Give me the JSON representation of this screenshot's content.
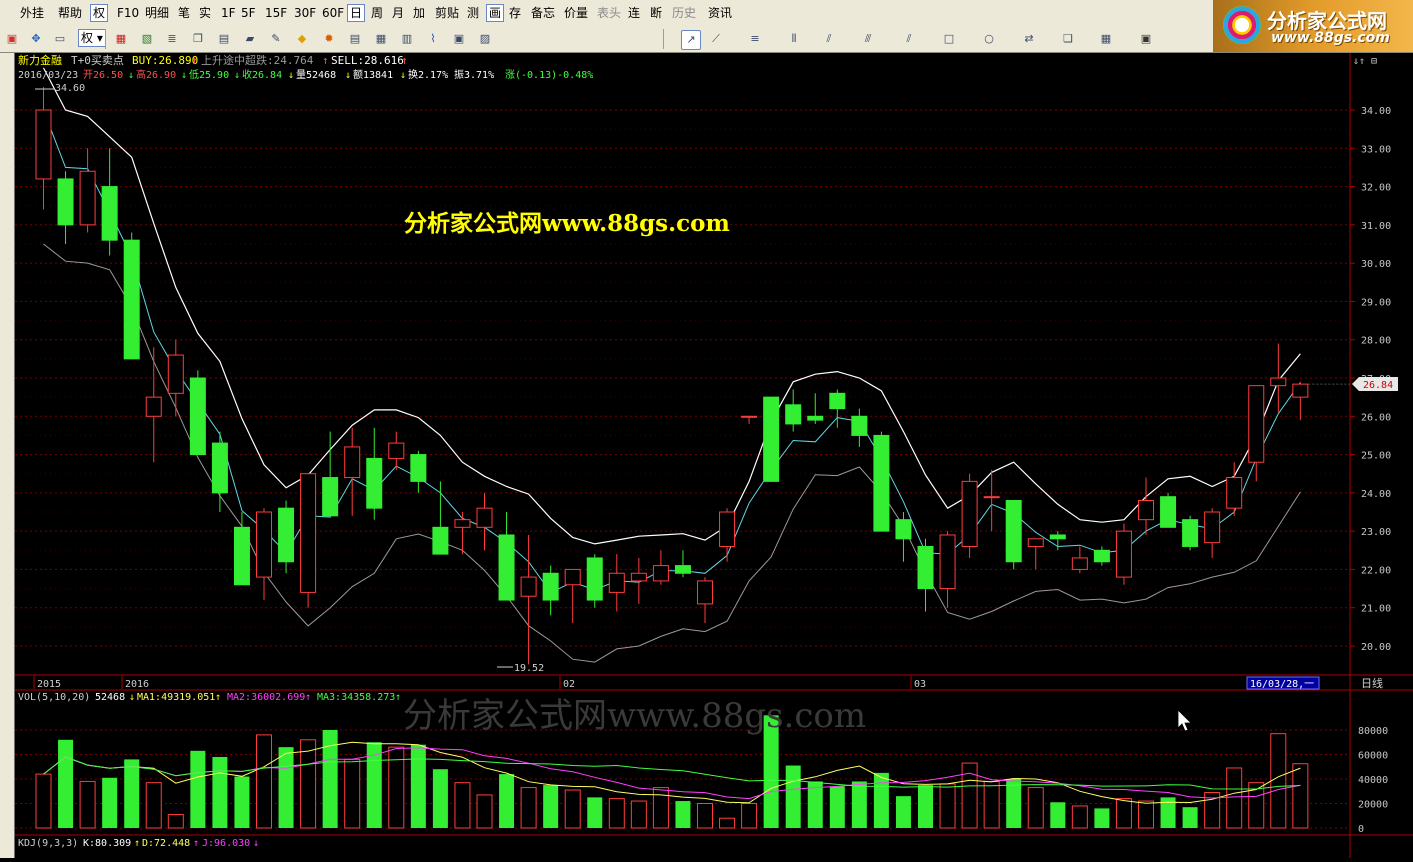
{
  "menu": {
    "items": [
      "外挂",
      "帮助",
      "权",
      "F10",
      "明细",
      "笔",
      "实",
      "1F",
      "5F",
      "15F",
      "30F",
      "60F",
      "日",
      "周",
      "月",
      "加",
      "剪贴",
      "测",
      "画",
      "存",
      "备忘",
      "价量",
      "表头",
      "连",
      "断",
      "历史",
      "资讯"
    ],
    "active": [
      "权",
      "日",
      "画"
    ],
    "disabled": [
      "表头",
      "历史"
    ]
  },
  "toolbar": {
    "quan_dropdown": "权",
    "icons": [
      "app-icon",
      "move-icon",
      "ruler-icon",
      "quan-dropdown",
      "red-chart-icon",
      "green-chart-icon",
      "bars-icon",
      "copy-icon",
      "note-icon",
      "eraser-icon",
      "edit-icon",
      "warning-icon",
      "target-icon",
      "compare-icon",
      "table-icon",
      "small-chart-icon",
      "line-chart-icon",
      "window-icon",
      "print-icon",
      "draw-cursor-icon",
      "line-tool-icon",
      "text-tool-icon",
      "vbars-tool-icon",
      "fan-tool-icon",
      "parallel-tool-icon",
      "channel-tool-icon",
      "rect-tool-icon",
      "ellipse-tool-icon",
      "arrow-tool-icon",
      "copy-tool-icon",
      "palette-icon",
      "save-icon"
    ]
  },
  "logo": {
    "title": "分析家公式网",
    "url": "www.88gs.com"
  },
  "header": {
    "stock_name": "新力金融",
    "indicator": "T+0买卖点",
    "buy": "BUY:26.890",
    "note": "上升途中超跌:24.764",
    "sell": "SELL:28.616",
    "date": "2016/03/23",
    "open": "开26.50",
    "high": "高26.90",
    "low": "低25.90",
    "close": "收26.84",
    "volume": "量52468",
    "amount": "额13841",
    "turnover": "换2.17%",
    "amplitude": "振3.71%",
    "change": "涨(-0.13)-0.48%"
  },
  "watermarks": {
    "main": "分析家公式网www.88gs.com",
    "volume": "分析家公式网www.88gs.com"
  },
  "scale_buttons": [
    "⇓⇑",
    "⊟"
  ],
  "colors": {
    "up": "#ff3c3c",
    "down": "#33ee33",
    "bg": "#000000",
    "grid": "#7a0000",
    "axis_text": "#c8c8c8",
    "ma1": "#ffff60",
    "ma2": "#ff40ff",
    "ma3": "#40ff40",
    "band_upper": "#ffffff",
    "band_lower": "#9a9a9a"
  },
  "x_axis": {
    "labels": [
      "2015",
      "2016",
      "02",
      "03"
    ],
    "cursor_date": "16/03/28,一",
    "period": "日线"
  },
  "price_panel": {
    "y_ticks": [
      "34.00",
      "33.00",
      "32.00",
      "31.00",
      "30.00",
      "29.00",
      "28.00",
      "27.00",
      "26.00",
      "25.00",
      "24.00",
      "23.00",
      "22.00",
      "21.00",
      "20.00"
    ],
    "current_price": "26.84",
    "max_label": "34.60",
    "min_label": "19.52"
  },
  "volume_panel": {
    "header": {
      "name": "VOL(5,10,20)",
      "value": "52468",
      "ma1": "MA1:49319.051",
      "ma2": "MA2:36002.699",
      "ma3": "MA3:34358.273"
    },
    "y_ticks": [
      "80000",
      "60000",
      "40000",
      "20000",
      "0"
    ]
  },
  "kdj_header": {
    "name": "KDJ(9,3,3)",
    "k": "K:80.309",
    "d": "D:72.448",
    "j": "J:96.030"
  },
  "chart_data": {
    "type": "candlestick",
    "title": "新力金融",
    "y_range": [
      19.52,
      34.6
    ],
    "volume_range": [
      0,
      80000
    ],
    "candles": [
      {
        "o": 32.2,
        "h": 34.6,
        "l": 31.4,
        "c": 34.0,
        "v": 44000
      },
      {
        "o": 32.2,
        "h": 32.4,
        "l": 30.5,
        "c": 31.0,
        "v": 72000
      },
      {
        "o": 31.0,
        "h": 33.0,
        "l": 30.8,
        "c": 32.4,
        "v": 38000
      },
      {
        "o": 32.0,
        "h": 33.0,
        "l": 30.2,
        "c": 30.6,
        "v": 41000
      },
      {
        "o": 30.6,
        "h": 30.8,
        "l": 27.5,
        "c": 27.5,
        "v": 56000
      },
      {
        "o": 26.0,
        "h": 27.8,
        "l": 24.8,
        "c": 26.5,
        "v": 37000
      },
      {
        "o": 26.6,
        "h": 28.0,
        "l": 26.0,
        "c": 27.6,
        "v": 11000
      },
      {
        "o": 27.0,
        "h": 27.2,
        "l": 25.0,
        "c": 25.0,
        "v": 63000
      },
      {
        "o": 25.3,
        "h": 25.6,
        "l": 23.5,
        "c": 24.0,
        "v": 58000
      },
      {
        "o": 23.1,
        "h": 23.5,
        "l": 21.6,
        "c": 21.6,
        "v": 42000
      },
      {
        "o": 21.8,
        "h": 23.6,
        "l": 21.2,
        "c": 23.5,
        "v": 76000
      },
      {
        "o": 23.6,
        "h": 23.8,
        "l": 21.9,
        "c": 22.2,
        "v": 66000
      },
      {
        "o": 21.4,
        "h": 24.5,
        "l": 21.0,
        "c": 24.5,
        "v": 72000
      },
      {
        "o": 24.4,
        "h": 25.6,
        "l": 23.5,
        "c": 23.4,
        "v": 80000
      },
      {
        "o": 24.4,
        "h": 25.7,
        "l": 23.4,
        "c": 25.2,
        "v": 56000
      },
      {
        "o": 24.9,
        "h": 25.7,
        "l": 23.3,
        "c": 23.6,
        "v": 70000
      },
      {
        "o": 24.9,
        "h": 25.6,
        "l": 24.6,
        "c": 25.3,
        "v": 66000
      },
      {
        "o": 25.0,
        "h": 25.1,
        "l": 24.0,
        "c": 24.3,
        "v": 68000
      },
      {
        "o": 23.1,
        "h": 24.3,
        "l": 22.6,
        "c": 22.4,
        "v": 48000
      },
      {
        "o": 23.1,
        "h": 23.5,
        "l": 22.4,
        "c": 23.3,
        "v": 37000
      },
      {
        "o": 23.1,
        "h": 24.0,
        "l": 22.5,
        "c": 23.6,
        "v": 27000
      },
      {
        "o": 22.9,
        "h": 23.5,
        "l": 21.3,
        "c": 21.2,
        "v": 44000
      },
      {
        "o": 21.3,
        "h": 22.9,
        "l": 19.52,
        "c": 21.8,
        "v": 33000
      },
      {
        "o": 21.9,
        "h": 22.1,
        "l": 20.8,
        "c": 21.2,
        "v": 35000
      },
      {
        "o": 21.6,
        "h": 22.0,
        "l": 20.6,
        "c": 22.0,
        "v": 31000
      },
      {
        "o": 22.3,
        "h": 22.4,
        "l": 21.0,
        "c": 21.2,
        "v": 25000
      },
      {
        "o": 21.4,
        "h": 22.4,
        "l": 20.9,
        "c": 21.9,
        "v": 24000
      },
      {
        "o": 21.7,
        "h": 22.3,
        "l": 21.1,
        "c": 21.9,
        "v": 22000
      },
      {
        "o": 21.7,
        "h": 22.5,
        "l": 21.6,
        "c": 22.1,
        "v": 33000
      },
      {
        "o": 22.1,
        "h": 22.5,
        "l": 21.8,
        "c": 21.9,
        "v": 22000
      },
      {
        "o": 21.1,
        "h": 21.8,
        "l": 20.6,
        "c": 21.7,
        "v": 20000
      },
      {
        "o": 22.6,
        "h": 23.6,
        "l": 22.2,
        "c": 23.5,
        "v": 8000
      },
      {
        "o": 26.0,
        "h": 26.0,
        "l": 25.8,
        "c": 26.0,
        "v": 20000
      },
      {
        "o": 26.5,
        "h": 26.5,
        "l": 24.3,
        "c": 24.3,
        "v": 92000
      },
      {
        "o": 26.3,
        "h": 26.7,
        "l": 25.6,
        "c": 25.8,
        "v": 51000
      },
      {
        "o": 26.0,
        "h": 26.6,
        "l": 25.8,
        "c": 25.9,
        "v": 38000
      },
      {
        "o": 26.6,
        "h": 26.7,
        "l": 25.7,
        "c": 26.2,
        "v": 34000
      },
      {
        "o": 26.0,
        "h": 26.2,
        "l": 25.2,
        "c": 25.5,
        "v": 38000
      },
      {
        "o": 25.5,
        "h": 25.6,
        "l": 23.0,
        "c": 23.0,
        "v": 45000
      },
      {
        "o": 23.3,
        "h": 23.5,
        "l": 22.2,
        "c": 22.8,
        "v": 26000
      },
      {
        "o": 22.6,
        "h": 22.8,
        "l": 20.9,
        "c": 21.5,
        "v": 35000
      },
      {
        "o": 21.5,
        "h": 23.0,
        "l": 21.0,
        "c": 22.9,
        "v": 36000
      },
      {
        "o": 22.6,
        "h": 24.5,
        "l": 22.3,
        "c": 24.3,
        "v": 53000
      },
      {
        "o": 23.9,
        "h": 24.6,
        "l": 23.0,
        "c": 23.9,
        "v": 38000
      },
      {
        "o": 23.8,
        "h": 23.8,
        "l": 22.0,
        "c": 22.2,
        "v": 40000
      },
      {
        "o": 22.6,
        "h": 22.8,
        "l": 22.0,
        "c": 22.8,
        "v": 33000
      },
      {
        "o": 22.9,
        "h": 23.0,
        "l": 22.5,
        "c": 22.8,
        "v": 21000
      },
      {
        "o": 22.0,
        "h": 22.6,
        "l": 21.9,
        "c": 22.3,
        "v": 18000
      },
      {
        "o": 22.5,
        "h": 22.6,
        "l": 22.1,
        "c": 22.2,
        "v": 16000
      },
      {
        "o": 21.8,
        "h": 23.2,
        "l": 21.6,
        "c": 23.0,
        "v": 24000
      },
      {
        "o": 23.3,
        "h": 24.4,
        "l": 22.9,
        "c": 23.8,
        "v": 22000
      },
      {
        "o": 23.9,
        "h": 24.0,
        "l": 23.1,
        "c": 23.1,
        "v": 25000
      },
      {
        "o": 23.3,
        "h": 23.4,
        "l": 22.5,
        "c": 22.6,
        "v": 17000
      },
      {
        "o": 22.7,
        "h": 23.6,
        "l": 22.3,
        "c": 23.5,
        "v": 29000
      },
      {
        "o": 23.6,
        "h": 24.8,
        "l": 23.4,
        "c": 24.4,
        "v": 49000
      },
      {
        "o": 24.8,
        "h": 26.6,
        "l": 24.3,
        "c": 26.8,
        "v": 37000
      },
      {
        "o": 26.8,
        "h": 27.9,
        "l": 26.1,
        "c": 27.0,
        "v": 77000
      },
      {
        "o": 26.5,
        "h": 26.9,
        "l": 25.9,
        "c": 26.84,
        "v": 52468
      }
    ]
  }
}
